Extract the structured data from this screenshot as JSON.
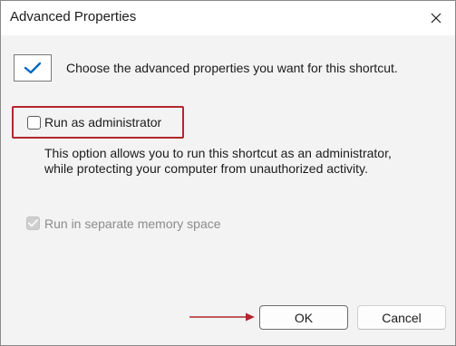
{
  "window": {
    "title": "Advanced Properties",
    "close_icon": "close-icon"
  },
  "intro": {
    "icon": "checkmark-icon",
    "text": "Choose the advanced properties you want for this shortcut."
  },
  "run_as_admin": {
    "label": "Run as administrator",
    "checked": false,
    "description_line1": "This option allows you to run this shortcut as an administrator,",
    "description_line2": "while protecting your computer from unauthorized activity."
  },
  "separate_memory": {
    "label": "Run in separate memory space",
    "checked": true,
    "disabled": true
  },
  "buttons": {
    "ok_label": "OK",
    "cancel_label": "Cancel"
  },
  "colors": {
    "accent": "#0067c0",
    "highlight": "#b22630"
  }
}
